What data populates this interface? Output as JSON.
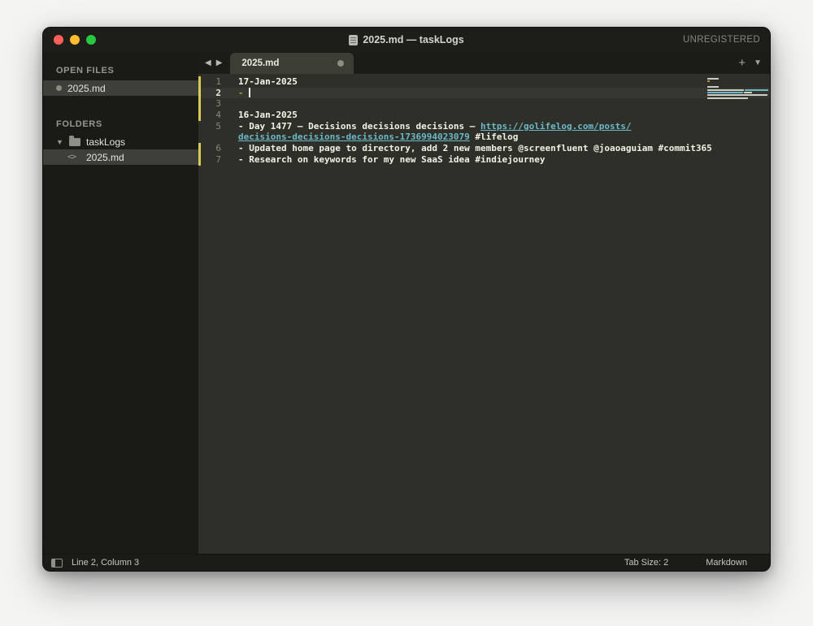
{
  "window": {
    "title": "2025.md — taskLogs",
    "registration": "UNREGISTERED"
  },
  "icons": {
    "prev_tab": "◀",
    "next_tab": "▶",
    "new_tab": "+",
    "tab_overflow": "▼",
    "folder_disclosure": "▼",
    "code_file": "<>"
  },
  "sidebar": {
    "open_files_header": "OPEN FILES",
    "open_file_label": "2025.md",
    "folders_header": "FOLDERS",
    "folder_label": "taskLogs",
    "folder_file_label": "2025.md"
  },
  "tabs": {
    "active_label": "2025.md"
  },
  "editor": {
    "rows": [
      {
        "num": "1",
        "segments": [
          {
            "t": "17-Jan-2025",
            "c": "heading"
          }
        ]
      },
      {
        "num": "2",
        "active": true,
        "cursor_after": true,
        "segments": [
          {
            "t": "-",
            "c": "bullet"
          },
          {
            "t": " ",
            "c": "plain"
          }
        ]
      },
      {
        "num": "3",
        "segments": []
      },
      {
        "num": "4",
        "segments": [
          {
            "t": "16-Jan-2025",
            "c": "heading"
          }
        ]
      },
      {
        "num": "5",
        "segments": [
          {
            "t": "- Day 1477 – Decisions decisions decisions – ",
            "c": "plain"
          },
          {
            "t": "https://golifelog.com/posts/",
            "c": "link"
          }
        ]
      },
      {
        "num": "",
        "segments": [
          {
            "t": "decisions-decisions-decisions-1736994023079",
            "c": "link"
          },
          {
            "t": " #lifelog",
            "c": "plain"
          }
        ]
      },
      {
        "num": "6",
        "segments": [
          {
            "t": "- Updated home page to directory, add 2 new members @screenfluent @joaoaguiam #commit365",
            "c": "plain"
          }
        ]
      },
      {
        "num": "7",
        "segments": [
          {
            "t": "- Research on keywords for my new SaaS idea #indiejourney",
            "c": "plain"
          }
        ]
      }
    ]
  },
  "status_bar": {
    "position": "Line 2, Column 3",
    "tab_size": "Tab Size: 2",
    "syntax": "Markdown"
  },
  "colors": {
    "editor_bg": "#2e2f28",
    "sidebar_bg": "#1a1a16",
    "titlebar_bg": "#1d1d1a",
    "bullet_orange": "#c98a3b",
    "link_cyan": "#6cb9c9",
    "diff_marker_yellow": "#d9c954",
    "traffic_red": "#ff5f57",
    "traffic_yellow": "#febc2e",
    "traffic_green": "#28c840"
  }
}
